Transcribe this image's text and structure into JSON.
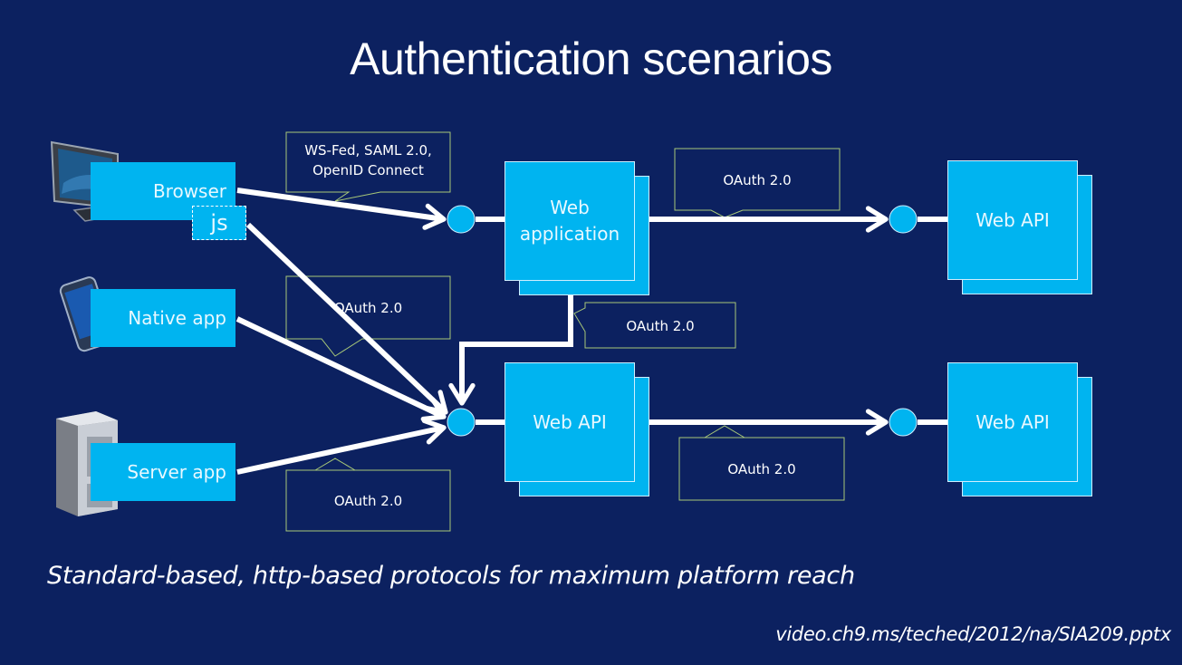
{
  "slide": {
    "title": "Authentication scenarios",
    "subtitle": "Standard-based, http-based protocols for maximum platform reach",
    "source": "video.ch9.ms/teched/2012/na/SIA209.pptx"
  },
  "colors": {
    "background": "#0c2160",
    "box_fill": "#00b4f0",
    "arrow": "#ffffff",
    "callout_border": "#a8c878"
  },
  "clients": [
    {
      "label": "Browser",
      "icon": "desktop-computer-icon",
      "tag": "js"
    },
    {
      "label": "Native app",
      "icon": "smartphone-icon"
    },
    {
      "label": "Server app",
      "icon": "server-tower-icon"
    }
  ],
  "nodes": {
    "web_application": "Web\napplication",
    "web_api_middle": "Web API",
    "web_api_top_right": "Web API",
    "web_api_bottom_right": "Web API"
  },
  "callouts": {
    "browser_to_webapp": [
      "WS-Fed, SAML 2.0,",
      "OpenID Connect"
    ],
    "webapp_to_webapi": "OAuth 2.0",
    "clients_to_webapi_top": "OAuth 2.0",
    "webapp_down_to_webapi": "OAuth 2.0",
    "server_to_webapi": "OAuth 2.0",
    "webapi_to_webapi": "OAuth 2.0"
  }
}
